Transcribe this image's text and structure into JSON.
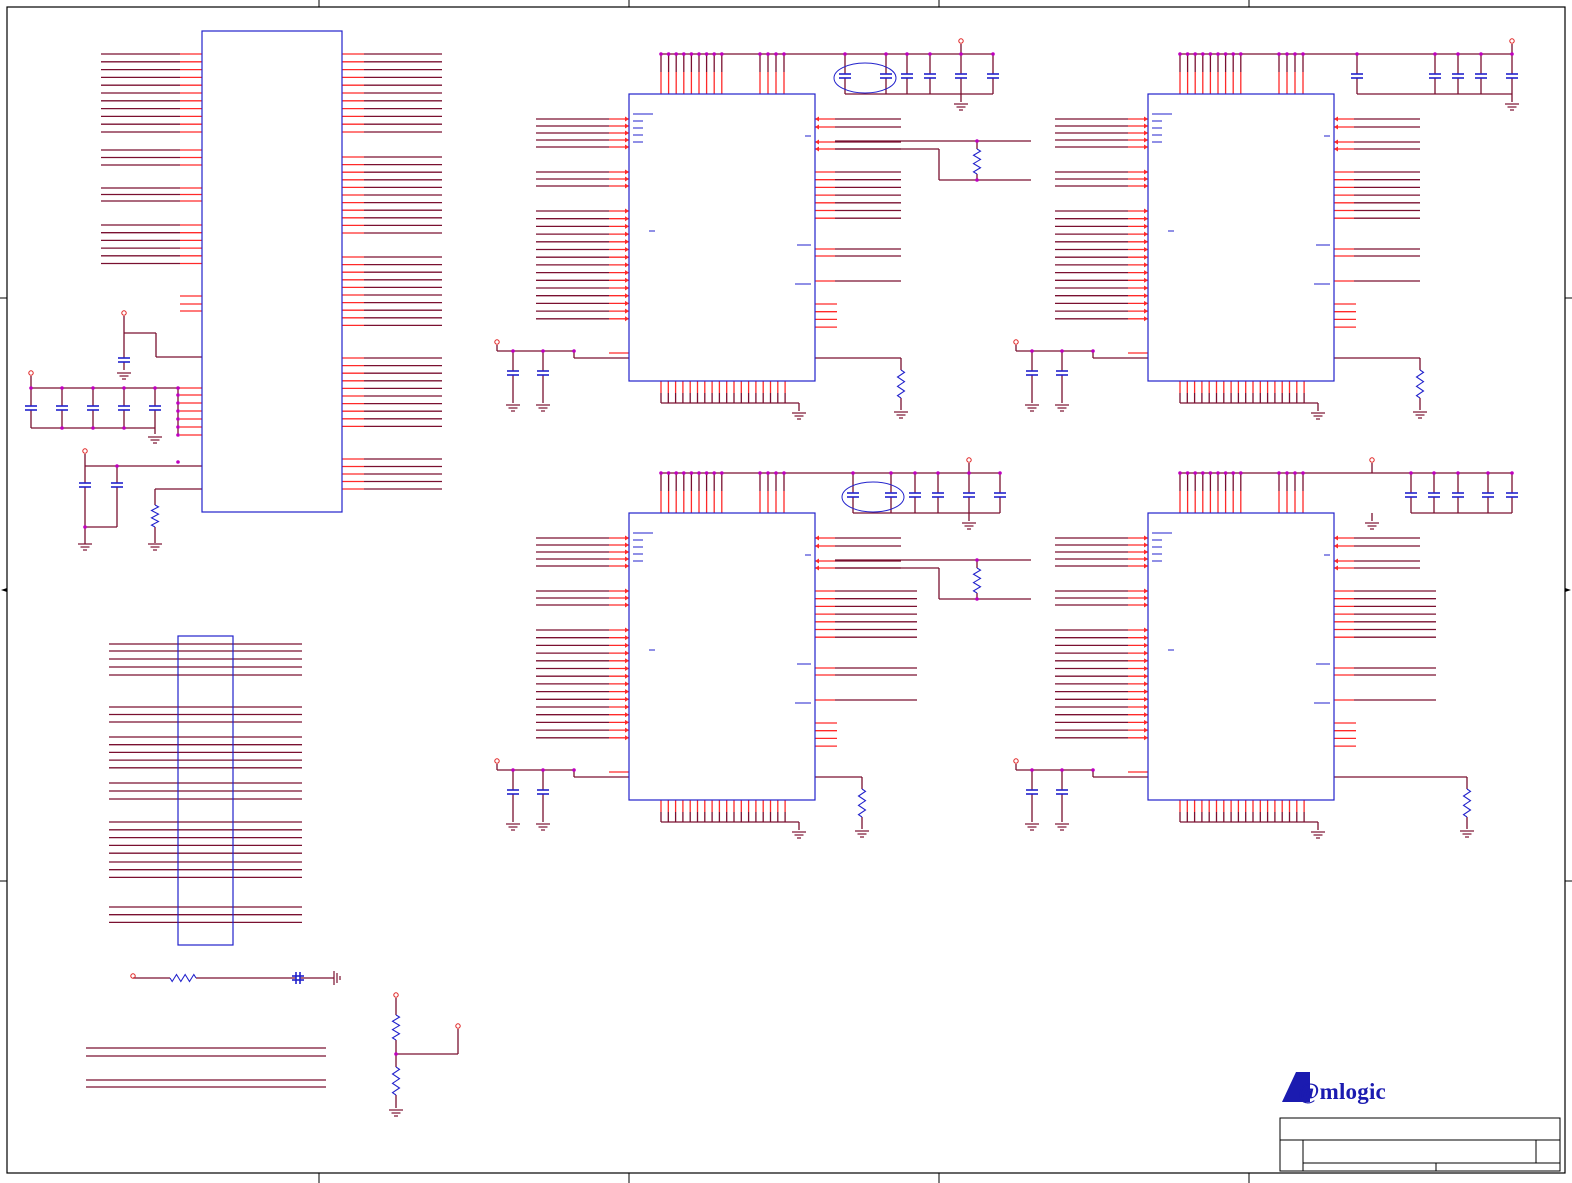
{
  "brand": {
    "logo_text": "@mlogic",
    "logo_color": "#1b1bb0"
  },
  "colors": {
    "net_wire": "#7a1030",
    "pin_stub": "#ff2a2a",
    "component_outline": "#2222cc",
    "junction": "#c000c0",
    "border": "#000000"
  },
  "blocks": [
    {
      "id": "connector-main",
      "kind": "connector"
    },
    {
      "id": "chip-top-left",
      "kind": "memory-ic"
    },
    {
      "id": "chip-top-right",
      "kind": "memory-ic"
    },
    {
      "id": "chip-bottom-left",
      "kind": "memory-ic"
    },
    {
      "id": "chip-bottom-right",
      "kind": "memory-ic"
    },
    {
      "id": "connector-secondary",
      "kind": "connector"
    }
  ]
}
